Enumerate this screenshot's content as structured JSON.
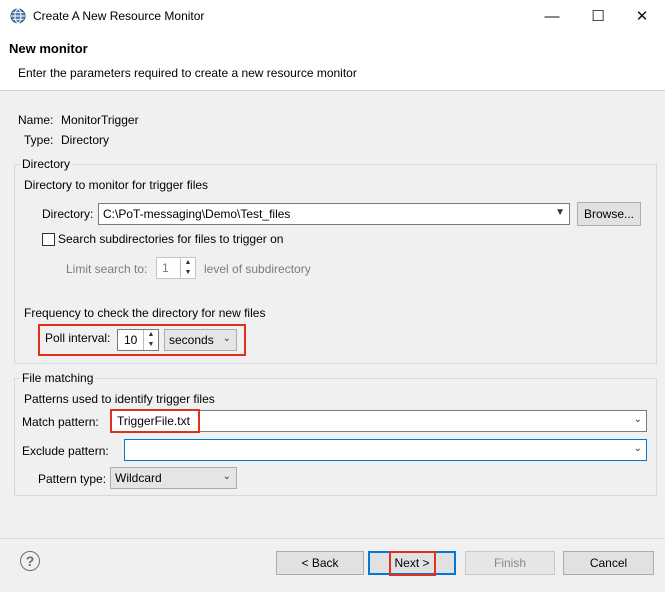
{
  "window": {
    "title": "Create A New Resource Monitor",
    "minimize": "—",
    "maximize": "☐",
    "close": "✕"
  },
  "header": {
    "title": "New monitor",
    "description": "Enter the parameters required to create a new resource monitor"
  },
  "info": {
    "name_label": "Name:",
    "name_value": "MonitorTrigger",
    "type_label": "Type:",
    "type_value": "Directory"
  },
  "directory_group": {
    "legend": "Directory",
    "subtitle": "Directory to monitor for trigger files",
    "directory_label": "Directory:",
    "directory_value": "C:\\PoT-messaging\\Demo\\Test_files",
    "browse_label": "Browse...",
    "search_subdirs_label": "Search subdirectories for files to trigger on",
    "search_subdirs_checked": false,
    "limit_label": "Limit search to:",
    "limit_value": "1",
    "limit_suffix": "level of subdirectory",
    "frequency_label": "Frequency to check the directory for new files",
    "poll_label": "Poll interval:",
    "poll_value": "10",
    "poll_unit": "seconds"
  },
  "file_matching_group": {
    "legend": "File matching",
    "subtitle": "Patterns used to identify trigger files",
    "match_label": "Match pattern:",
    "match_value": "TriggerFile.txt",
    "exclude_label": "Exclude pattern:",
    "exclude_value": "",
    "pattern_type_label": "Pattern type:",
    "pattern_type_value": "Wildcard"
  },
  "footer": {
    "help": "?",
    "back_label": "< Back",
    "next_label": "Next >",
    "finish_label": "Finish",
    "cancel_label": "Cancel"
  },
  "colors": {
    "highlight_border": "#e0301e",
    "focus_border": "#0078d7"
  }
}
